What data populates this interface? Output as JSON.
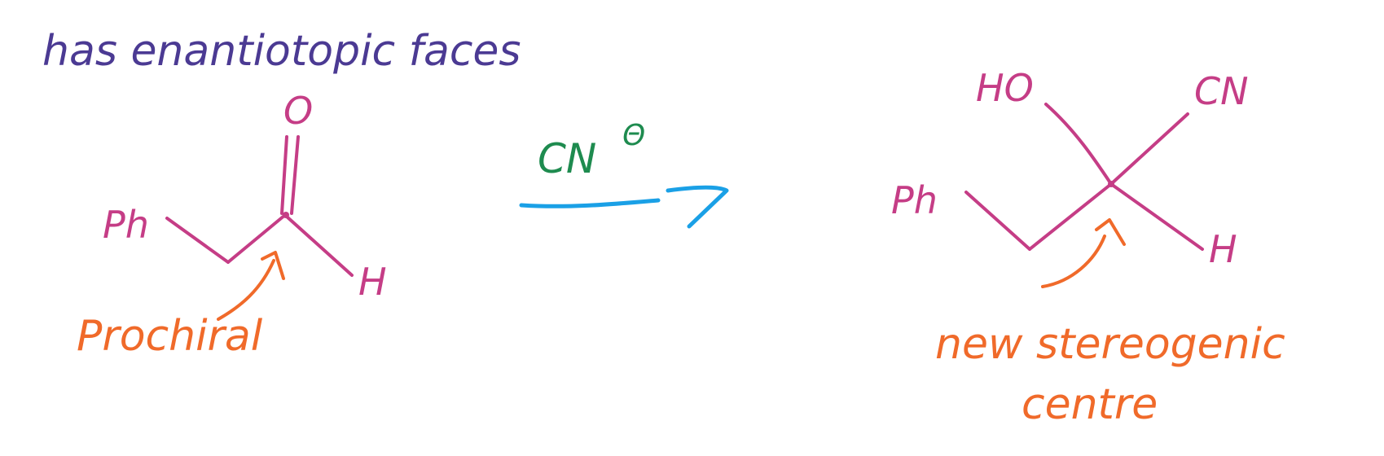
{
  "heading": {
    "text": "has enantiotopic faces"
  },
  "starting_material": {
    "carbonyl_oxygen": "O",
    "phenyl": "Ph",
    "hydrogen": "H",
    "annotation": "Prochiral"
  },
  "reagent": {
    "formula": "CN",
    "charge": "Θ"
  },
  "product": {
    "hydroxyl": "HO",
    "nitrile": "CN",
    "phenyl": "Ph",
    "hydrogen": "H",
    "annotation_line1": "new stereogenic",
    "annotation_line2": "centre"
  },
  "colors": {
    "heading": "#4b3a93",
    "molecule": "#c53d86",
    "annotation": "#f06a2a",
    "reagent": "#1e8b4f",
    "arrow": "#1aa0e6",
    "background": "#ffffff"
  },
  "icons": {
    "reaction_arrow": "half-arrow",
    "pointer": "curved-arrow"
  }
}
